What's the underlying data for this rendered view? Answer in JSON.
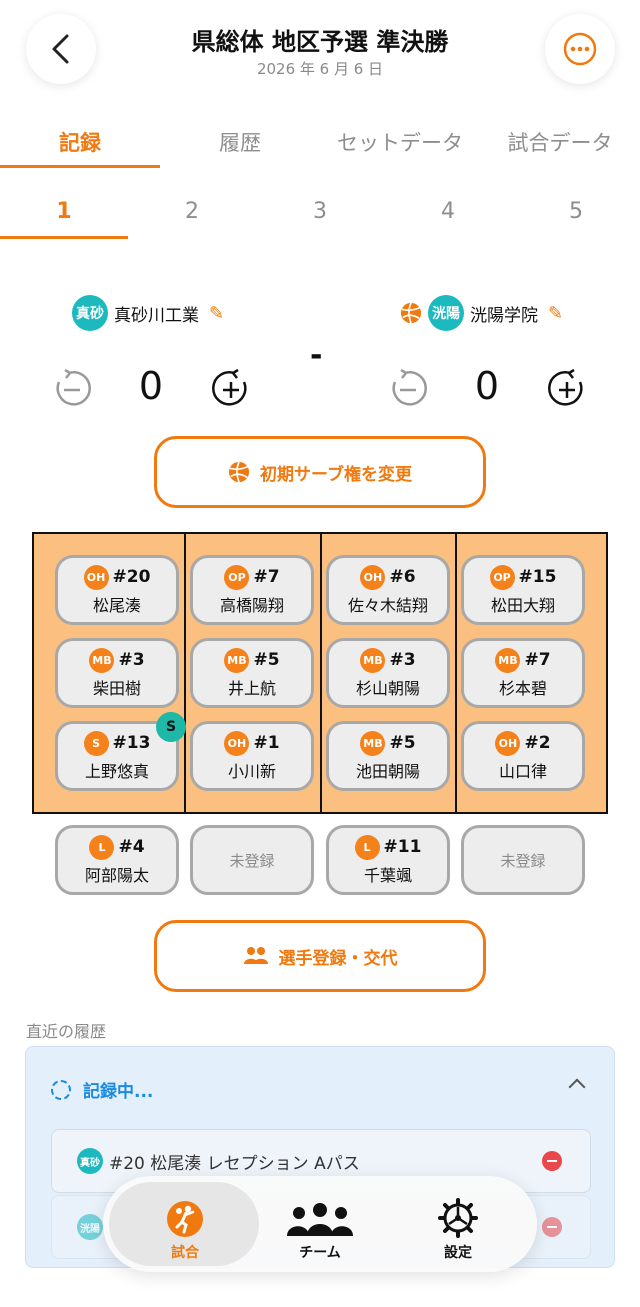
{
  "header": {
    "title": "県総体 地区予選 準決勝",
    "date": "2026 年 6 月 6 日"
  },
  "tabs": [
    {
      "label": "記録",
      "active": true
    },
    {
      "label": "履歴",
      "active": false
    },
    {
      "label": "セットデータ",
      "active": false
    },
    {
      "label": "試合データ",
      "active": false
    }
  ],
  "sets": [
    {
      "label": "1",
      "active": true
    },
    {
      "label": "2",
      "active": false
    },
    {
      "label": "3",
      "active": false
    },
    {
      "label": "4",
      "active": false
    },
    {
      "label": "5",
      "active": false
    }
  ],
  "home": {
    "badge": "真砂",
    "name": "真砂川工業",
    "score": "0"
  },
  "away": {
    "badge": "洸陽",
    "name": "洸陽学院",
    "score": "0",
    "serving": true
  },
  "score_separator": "-",
  "serve_button": {
    "label": "初期サーブ権を変更",
    "icon": "volleyball-icon"
  },
  "court": {
    "rows": [
      [
        {
          "pos": "OH",
          "num": "#20",
          "name": "松尾湊"
        },
        {
          "pos": "OP",
          "num": "#7",
          "name": "高橋陽翔"
        },
        {
          "pos": "OH",
          "num": "#6",
          "name": "佐々木結翔"
        },
        {
          "pos": "OP",
          "num": "#15",
          "name": "松田大翔"
        }
      ],
      [
        {
          "pos": "MB",
          "num": "#3",
          "name": "柴田樹"
        },
        {
          "pos": "MB",
          "num": "#5",
          "name": "井上航"
        },
        {
          "pos": "MB",
          "num": "#3",
          "name": "杉山朝陽"
        },
        {
          "pos": "MB",
          "num": "#7",
          "name": "杉本碧"
        }
      ],
      [
        {
          "pos": "S",
          "num": "#13",
          "name": "上野悠真"
        },
        {
          "pos": "OH",
          "num": "#1",
          "name": "小川新"
        },
        {
          "pos": "MB",
          "num": "#5",
          "name": "池田朝陽"
        },
        {
          "pos": "OH",
          "num": "#2",
          "name": "山口律"
        }
      ]
    ],
    "setter_badge": "S"
  },
  "liberos": [
    {
      "pos": "L",
      "num": "#4",
      "name": "阿部陽太"
    },
    {
      "unregistered": "未登録"
    },
    {
      "pos": "L",
      "num": "#11",
      "name": "千葉颯"
    },
    {
      "unregistered": "未登録"
    }
  ],
  "player_button": {
    "label": "選手登録・交代",
    "icon": "people-icon"
  },
  "history": {
    "label": "直近の履歴",
    "status": "記録中...",
    "items": [
      {
        "badge": "真砂",
        "text": "#20 松尾湊 レセプション Aパス"
      },
      {
        "badge": "洸陽",
        "text": ""
      }
    ]
  },
  "nav": [
    {
      "label": "試合",
      "icon": "volleyball-player-icon",
      "active": true
    },
    {
      "label": "チーム",
      "icon": "team-icon",
      "active": false
    },
    {
      "label": "設定",
      "icon": "gear-icon",
      "active": false
    }
  ],
  "colors": {
    "accent": "#f07a10",
    "teal": "#1cb9bf",
    "court": "#fbbf80",
    "record_blue": "#1a8be0",
    "delete_red": "#e8474c"
  }
}
